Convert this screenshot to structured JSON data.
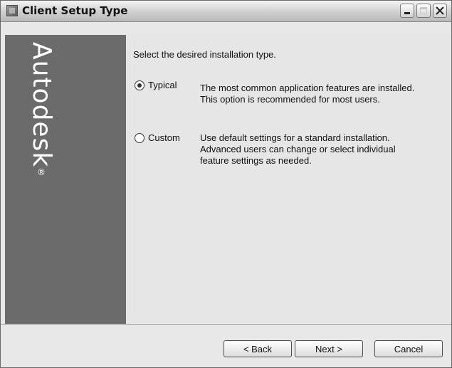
{
  "window": {
    "title": "Client Setup Type",
    "app_icon": "setup-icon",
    "controls": [
      "minimize-icon",
      "maximize-icon",
      "close-icon"
    ]
  },
  "sidebar": {
    "brand": "Autodesk",
    "brand_mark": "®",
    "color": "#6b6b6b"
  },
  "main": {
    "prompt": "Select the desired installation type.",
    "options": [
      {
        "label": "Typical",
        "selected": true,
        "description_lines": [
          "The most common application features are installed.",
          "This option is recommended for most users."
        ]
      },
      {
        "label": "Custom",
        "selected": false,
        "description_lines": [
          "Use default settings for a standard installation.",
          "Advanced users can change or select individual",
          "feature settings as needed."
        ]
      }
    ]
  },
  "buttons": {
    "back": "< Back",
    "next": "Next >",
    "cancel": "Cancel"
  }
}
